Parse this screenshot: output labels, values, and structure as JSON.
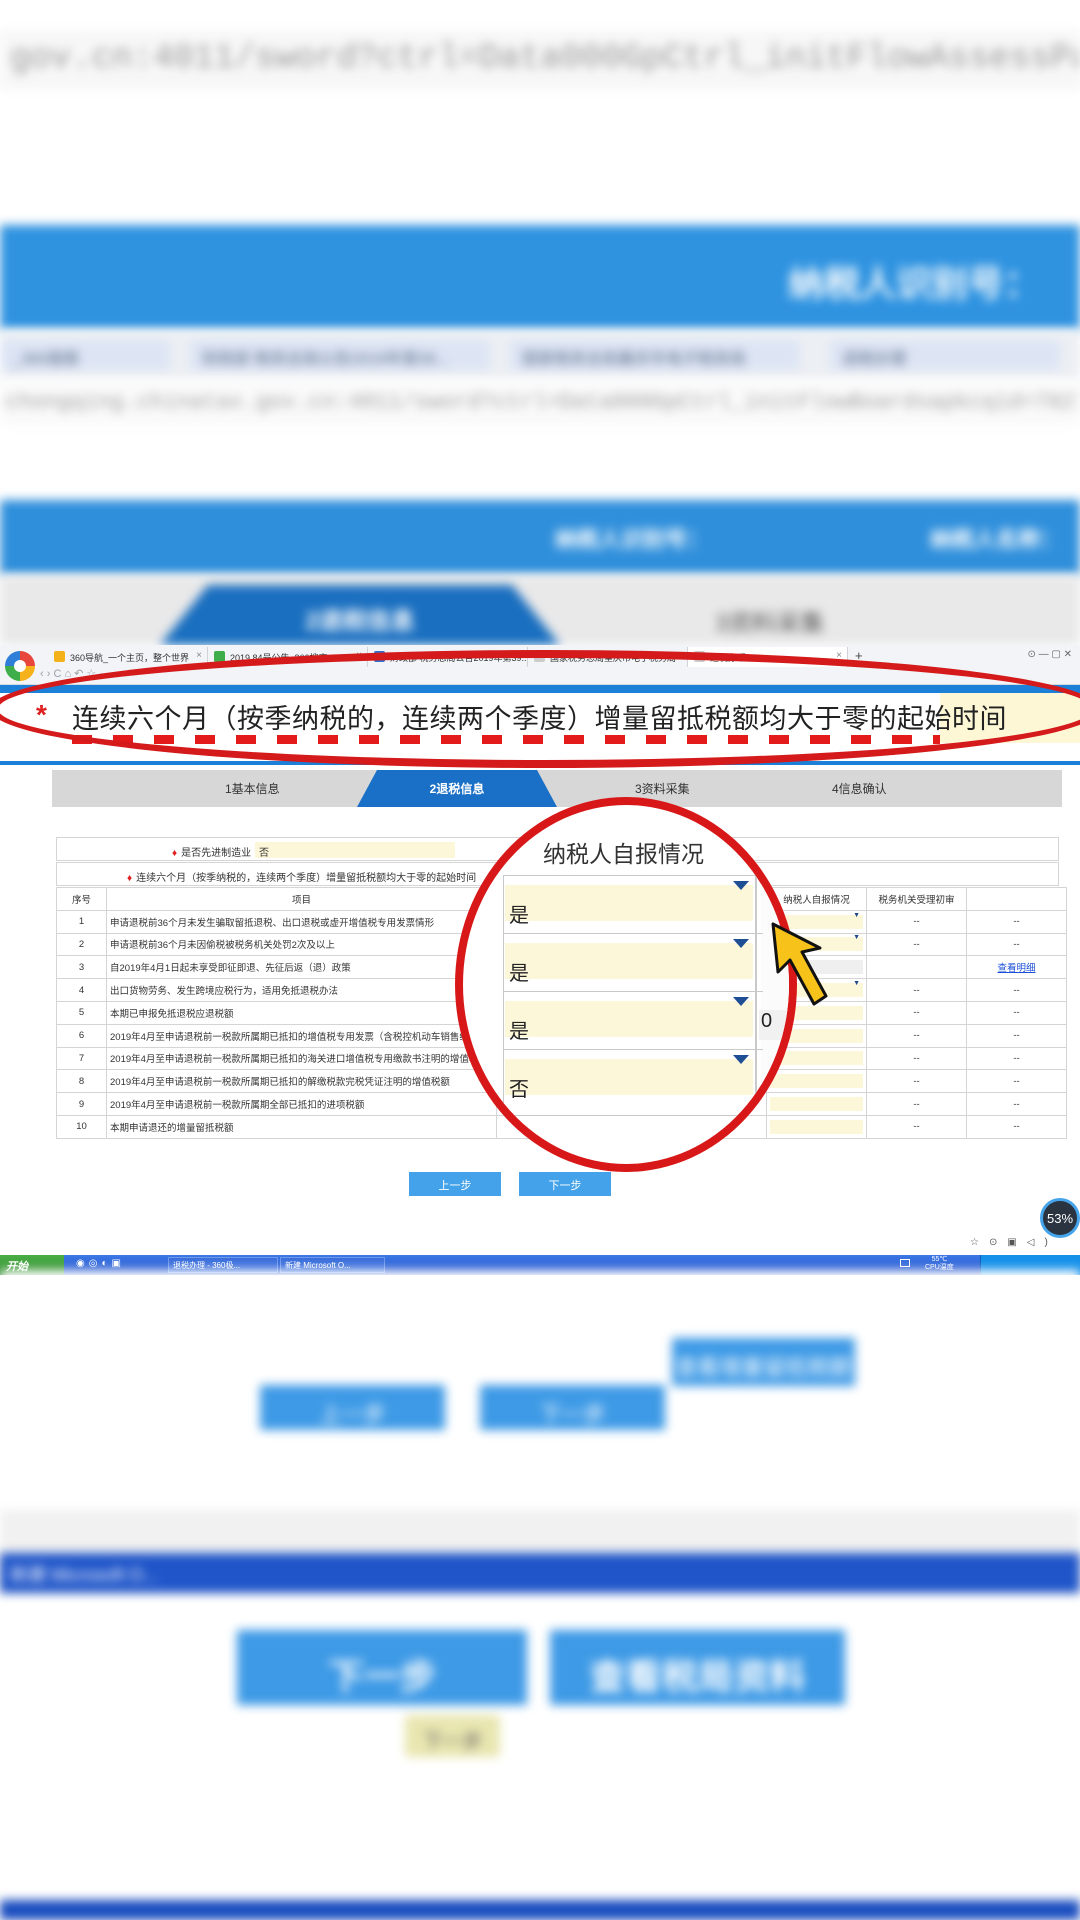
{
  "background": {
    "url_top": "gov.cn:4011/sword?ctrl=Data000GpCtrl_initFlowAssessParam=nc0FNK",
    "header_blue_text": "纳税人识别号：",
    "blur_tabs": [
      "_360搜索",
      "财政部 税务总局公告2019年第39...",
      "国家税务总局重庆市电子税务局",
      "退税办理"
    ],
    "url_mid": "chongqing.chinatax.gov.cn:4011/sword?ctrl=Data000GpCtrl_initFlowBoardsapkcqid=7827CbeeIc3",
    "header2_id": "纳税人识别号：",
    "header2_name": "纳税人名称：",
    "steps_active": "2退税信息",
    "steps_next": "3资料采集",
    "low_buttons": [
      "上一步",
      "下一步",
      "查看增量留抵税额"
    ],
    "taskbar_blur": "新建 Microsoft O...",
    "big_buttons": [
      "下一步",
      "查看税局资料"
    ],
    "small_yellow": "下一步"
  },
  "browser": {
    "tabs": [
      {
        "label": "360导航_一个主页，整个世界",
        "color": "#f3b21a"
      },
      {
        "label": "2019 84号公告_360搜索",
        "color": "#3fae4a"
      },
      {
        "label": "财政部 税务总局公告2019年第39...",
        "color": "#2f6fd1"
      },
      {
        "label": "国家税务总局重庆市电子税务局",
        "color": "#cccccc"
      },
      {
        "label": "退税办理",
        "color": "#cccccc"
      }
    ],
    "plus": "+",
    "nav": "‹ › C ⌂ ↶ ☆ ·"
  },
  "banner": {
    "star": "*",
    "text": "连续六个月（按季纳税的，连续两个季度）增量留抵税额均大于零的起始时间"
  },
  "steps": [
    "1基本信息",
    "2退税信息",
    "3资料采集",
    "4信息确认"
  ],
  "form": {
    "row1_label": "是否先进制造业",
    "row1_value": "否",
    "row2_label": "连续六个月（按季纳税的，连续两个季度）增量留抵税额均大于零的起始时间",
    "headers": [
      "序号",
      "项目",
      "纳税人自报情况",
      "税务机关受理初审",
      ""
    ],
    "rows": [
      {
        "no": "1",
        "item": "申请退税前36个月未发生骗取留抵退税、出口退税或虚开增值税专用发票情形",
        "self": "",
        "review": "--",
        "extra": "--"
      },
      {
        "no": "2",
        "item": "申请退税前36个月未因偷税被税务机关处罚2次及以上",
        "self": "",
        "review": "--",
        "extra": "--"
      },
      {
        "no": "3",
        "item": "自2019年4月1日起未享受即征即退、先征后返（退）政策",
        "self": "0",
        "review": "",
        "extra": "查看明细"
      },
      {
        "no": "4",
        "item": "出口货物劳务、发生跨境应税行为，适用免抵退税办法",
        "self": "",
        "review": "--",
        "extra": "--"
      },
      {
        "no": "5",
        "item": "本期已申报免抵退税应退税额",
        "self": "",
        "review": "--",
        "extra": "--"
      },
      {
        "no": "6",
        "item": "2019年4月至申请退税前一税款所属期已抵扣的增值税专用发票（含税控机动车销售统一发票）注明的增值税额",
        "self": "",
        "review": "--",
        "extra": "--"
      },
      {
        "no": "7",
        "item": "2019年4月至申请退税前一税款所属期已抵扣的海关进口增值税专用缴款书注明的增值税额",
        "self": "",
        "review": "--",
        "extra": "--"
      },
      {
        "no": "8",
        "item": "2019年4月至申请退税前一税款所属期已抵扣的解缴税款完税凭证注明的增值税额",
        "self": "",
        "review": "--",
        "extra": "--"
      },
      {
        "no": "9",
        "item": "2019年4月至申请退税前一税款所属期全部已抵扣的进项税额",
        "self": "",
        "review": "--",
        "extra": "--"
      },
      {
        "no": "10",
        "item": "本期申请退还的增量留抵税额",
        "self": "",
        "review": "--",
        "extra": "--"
      }
    ]
  },
  "buttons": {
    "prev": "上一步",
    "next": "下一步"
  },
  "badge": "53%",
  "taskbar": {
    "start": "开始",
    "items": [
      "退税办理 - 360极...",
      "新建 Microsoft O..."
    ],
    "temp_line1": "55℃",
    "temp_line2": "CPU温度"
  },
  "lens": {
    "title": "纳税人自报情况",
    "values": [
      "是",
      "是",
      "是",
      "否"
    ],
    "right_value": "0"
  },
  "colors": {
    "brand_blue": "#1c7fd8",
    "highlight_red": "#d81818",
    "field_yellow": "#fdf7d9",
    "cursor_yellow": "#f7c31a"
  }
}
